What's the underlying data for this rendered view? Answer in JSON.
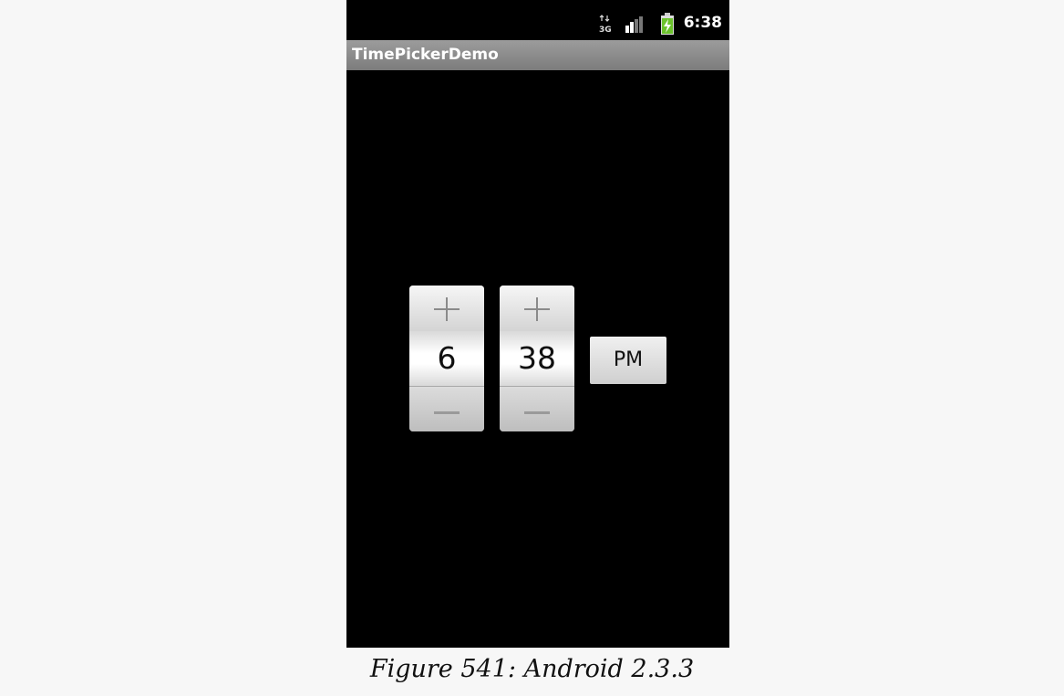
{
  "status_bar": {
    "time": "6:38",
    "network_label": "3G",
    "icons": [
      "network-3g-icon",
      "signal-icon",
      "battery-charging-icon"
    ]
  },
  "app": {
    "title": "TimePickerDemo"
  },
  "time_picker": {
    "hour": "6",
    "minute": "38",
    "am_pm": "PM"
  },
  "caption": "Figure 541: Android 2.3.3",
  "colors": {
    "screen_background": "#000000",
    "title_bar": "#8c8c8c",
    "page_background": "#f7f7f7",
    "battery_green": "#6cc22c"
  }
}
